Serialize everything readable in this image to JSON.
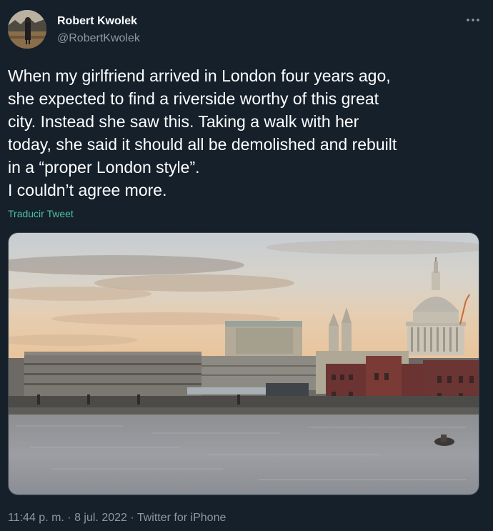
{
  "author": {
    "display_name": "Robert Kwolek",
    "handle": "@RobertKwolek"
  },
  "tweet": {
    "lines": [
      "When my girlfriend arrived in London four years ago,",
      "she expected to find a riverside worthy of this great",
      "city. Instead she saw this. Taking a walk with her",
      "today, she said it should all be demolished and rebuilt",
      "in a “proper London style”.",
      "I couldn’t agree more."
    ],
    "translate_label": "Traducir Tweet"
  },
  "meta": {
    "time": "11:44 p. m.",
    "separator": " · ",
    "date": "8 jul. 2022",
    "source": "Twitter for iPhone"
  },
  "icons": {
    "more": "more-dots-icon"
  },
  "colors": {
    "background": "#15202b",
    "secondary_text": "#8b98a5",
    "link": "#4fbf9e"
  }
}
